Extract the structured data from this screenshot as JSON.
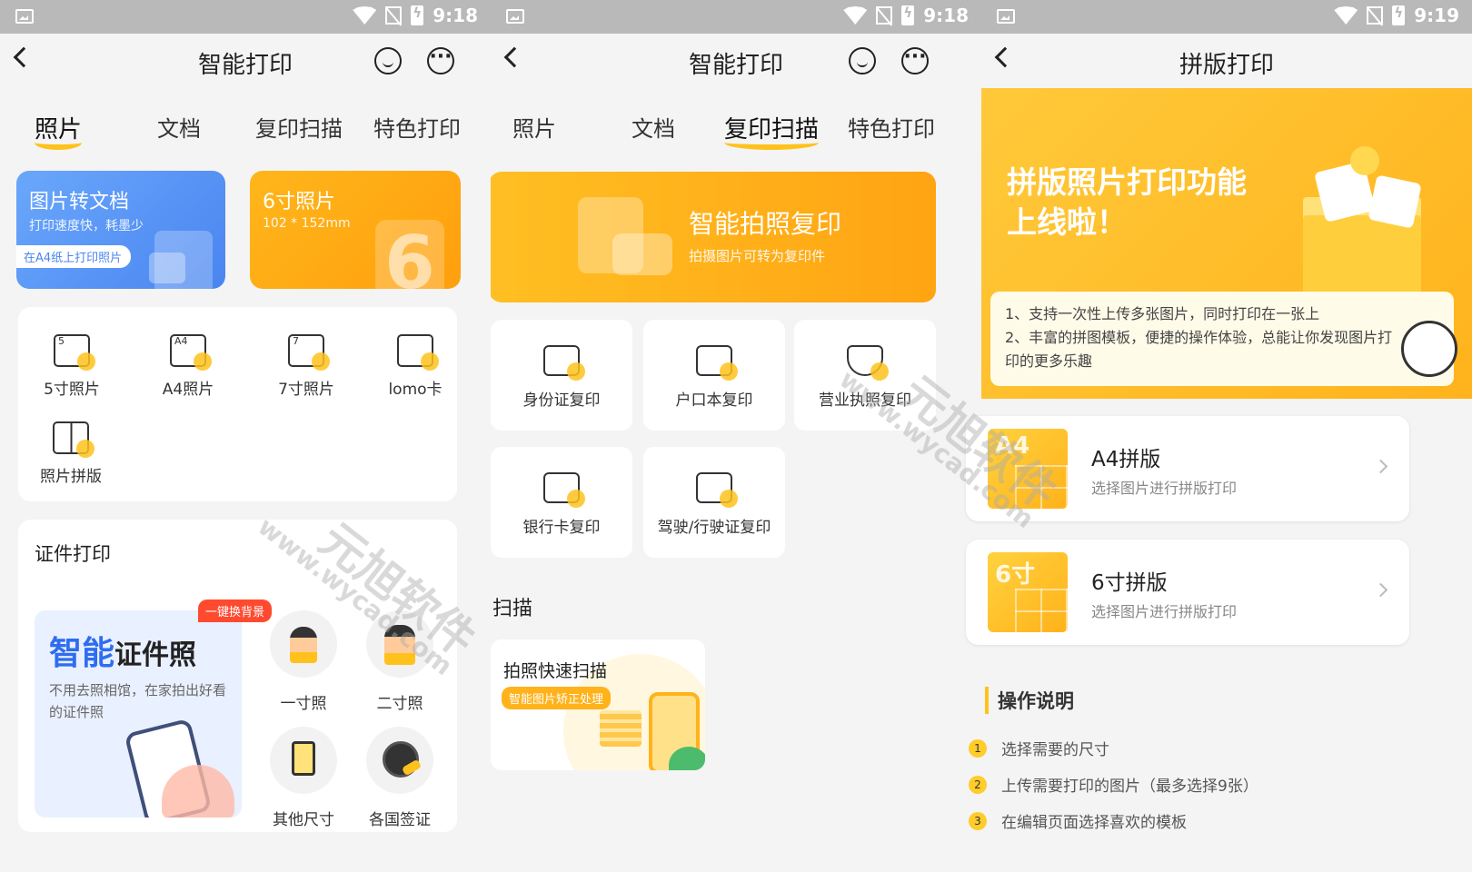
{
  "screens": [
    {
      "time": "9:18",
      "title": "智能打印"
    },
    {
      "time": "9:18",
      "title": "智能打印"
    },
    {
      "time": "9:19",
      "title": "拼版打印"
    }
  ],
  "tabs": [
    "照片",
    "文档",
    "复印扫描",
    "特色打印"
  ],
  "photo": {
    "banner_left": {
      "title": "图片转文档",
      "sub": "打印速度快，耗墨少",
      "pill": "在A4纸上打印照片"
    },
    "banner_right": {
      "title": "6寸照片",
      "sub": "102 * 152mm",
      "glyph": "6"
    },
    "grid": [
      {
        "label": "5寸照片",
        "tag": "5"
      },
      {
        "label": "A4照片",
        "tag": "A4"
      },
      {
        "label": "7寸照片",
        "tag": "7"
      },
      {
        "label": "lomo卡",
        "tag": ""
      },
      {
        "label": "照片拼版",
        "tag": ""
      }
    ],
    "cert": {
      "heading": "证件打印",
      "badge": "一键换背景",
      "big1": "智能",
      "big2": "证件照",
      "desc": "不用去照相馆，在家拍出好看的证件照",
      "items": [
        "一寸照",
        "二寸照",
        "其他尺寸",
        "各国签证"
      ]
    }
  },
  "copy": {
    "hero": {
      "title": "智能拍照复印",
      "sub": "拍摄图片可转为复印件"
    },
    "grid": [
      "身份证复印",
      "户口本复印",
      "营业执照复印",
      "银行卡复印",
      "驾驶/行驶证复印"
    ],
    "scan_heading": "扫描",
    "scan_card": {
      "title": "拍照快速扫描",
      "pill": "智能图片矫正处理"
    }
  },
  "layout_print": {
    "hero_title1": "拼版照片打印功能",
    "hero_title2": "上线啦！",
    "hero_desc1": "1、支持一次性上传多张图片，同时打印在一张上",
    "hero_desc2": "2、丰富的拼图模板，便捷的操作体验，总能让你发现图片打印的更多乐趣",
    "options": [
      {
        "thumb": "A4",
        "title": "A4拼版",
        "sub": "选择图片进行拼版打印"
      },
      {
        "thumb": "6寸",
        "title": "6寸拼版",
        "sub": "选择图片进行拼版打印"
      }
    ],
    "instructions_title": "操作说明",
    "steps": [
      {
        "n": "1",
        "text": "选择需要的尺寸"
      },
      {
        "n": "2",
        "text": "上传需要打印的图片（最多选择9张）"
      },
      {
        "n": "3",
        "text": "在编辑页面选择喜欢的模板"
      }
    ]
  },
  "watermark": {
    "text1": "元旭软件",
    "text2": "www.wycad.com"
  },
  "colors": {
    "accent": "#ffc21c",
    "blue": "#4a85f0",
    "orange": "#ffa412",
    "badge": "#ff4a30"
  }
}
